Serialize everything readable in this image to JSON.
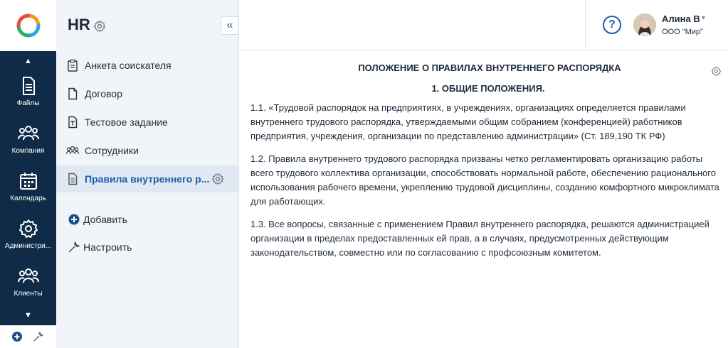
{
  "rail": {
    "items": [
      {
        "label": "Файлы",
        "icon": "file-icon"
      },
      {
        "label": "Компания",
        "icon": "people-icon"
      },
      {
        "label": "Календарь",
        "icon": "calendar-icon"
      },
      {
        "label": "Администри...",
        "icon": "gear-icon"
      },
      {
        "label": "Клиенты",
        "icon": "people-icon"
      }
    ]
  },
  "sidebar": {
    "title": "HR",
    "items": [
      {
        "label": "Анкета соискателя",
        "icon": "clipboard-icon"
      },
      {
        "label": "Договор",
        "icon": "document-icon"
      },
      {
        "label": "Тестовое задание",
        "icon": "test-file-icon"
      },
      {
        "label": "Сотрудники",
        "icon": "people-icon"
      },
      {
        "label": "Правила внутреннего р...",
        "icon": "document-lines-icon",
        "active": true
      }
    ],
    "add_label": "Добавить",
    "configure_label": "Настроить"
  },
  "header": {
    "help": "?",
    "user_name": "Алина В",
    "user_org": "ООО \"Мир\""
  },
  "document": {
    "title": "ПОЛОЖЕНИЕ О ПРАВИЛАХ ВНУТРЕННЕГО РАСПОРЯДКА",
    "section": "1. ОБЩИЕ ПОЛОЖЕНИЯ.",
    "paragraphs": [
      "1.1. «Трудовой распорядок на предприятиях, в учреждениях, организациях определяется правилами внутреннего трудового распорядка, утверждаемыми общим собранием (конференцией) работников предприятия, учреждения, организации по представлению администрации» (Ст. 189,190 ТК РФ)",
      "1.2. Правила внутреннего трудового распорядка призваны четко регламентировать организацию работы всего трудового коллектива организации, способствовать нормальной работе, обеспечению рационального использования рабочего времени, укреплению трудовой дисциплины, созданию комфортного микроклимата для работающих.",
      "1.3. Все вопросы, связанные с применением Правил внутреннего распорядка, решаются администрацией организации в пределах предоставленных ей прав, а в случаях, предусмотренных действующим законодательством, совместно или по согласованию с профсоюзным комитетом."
    ]
  }
}
